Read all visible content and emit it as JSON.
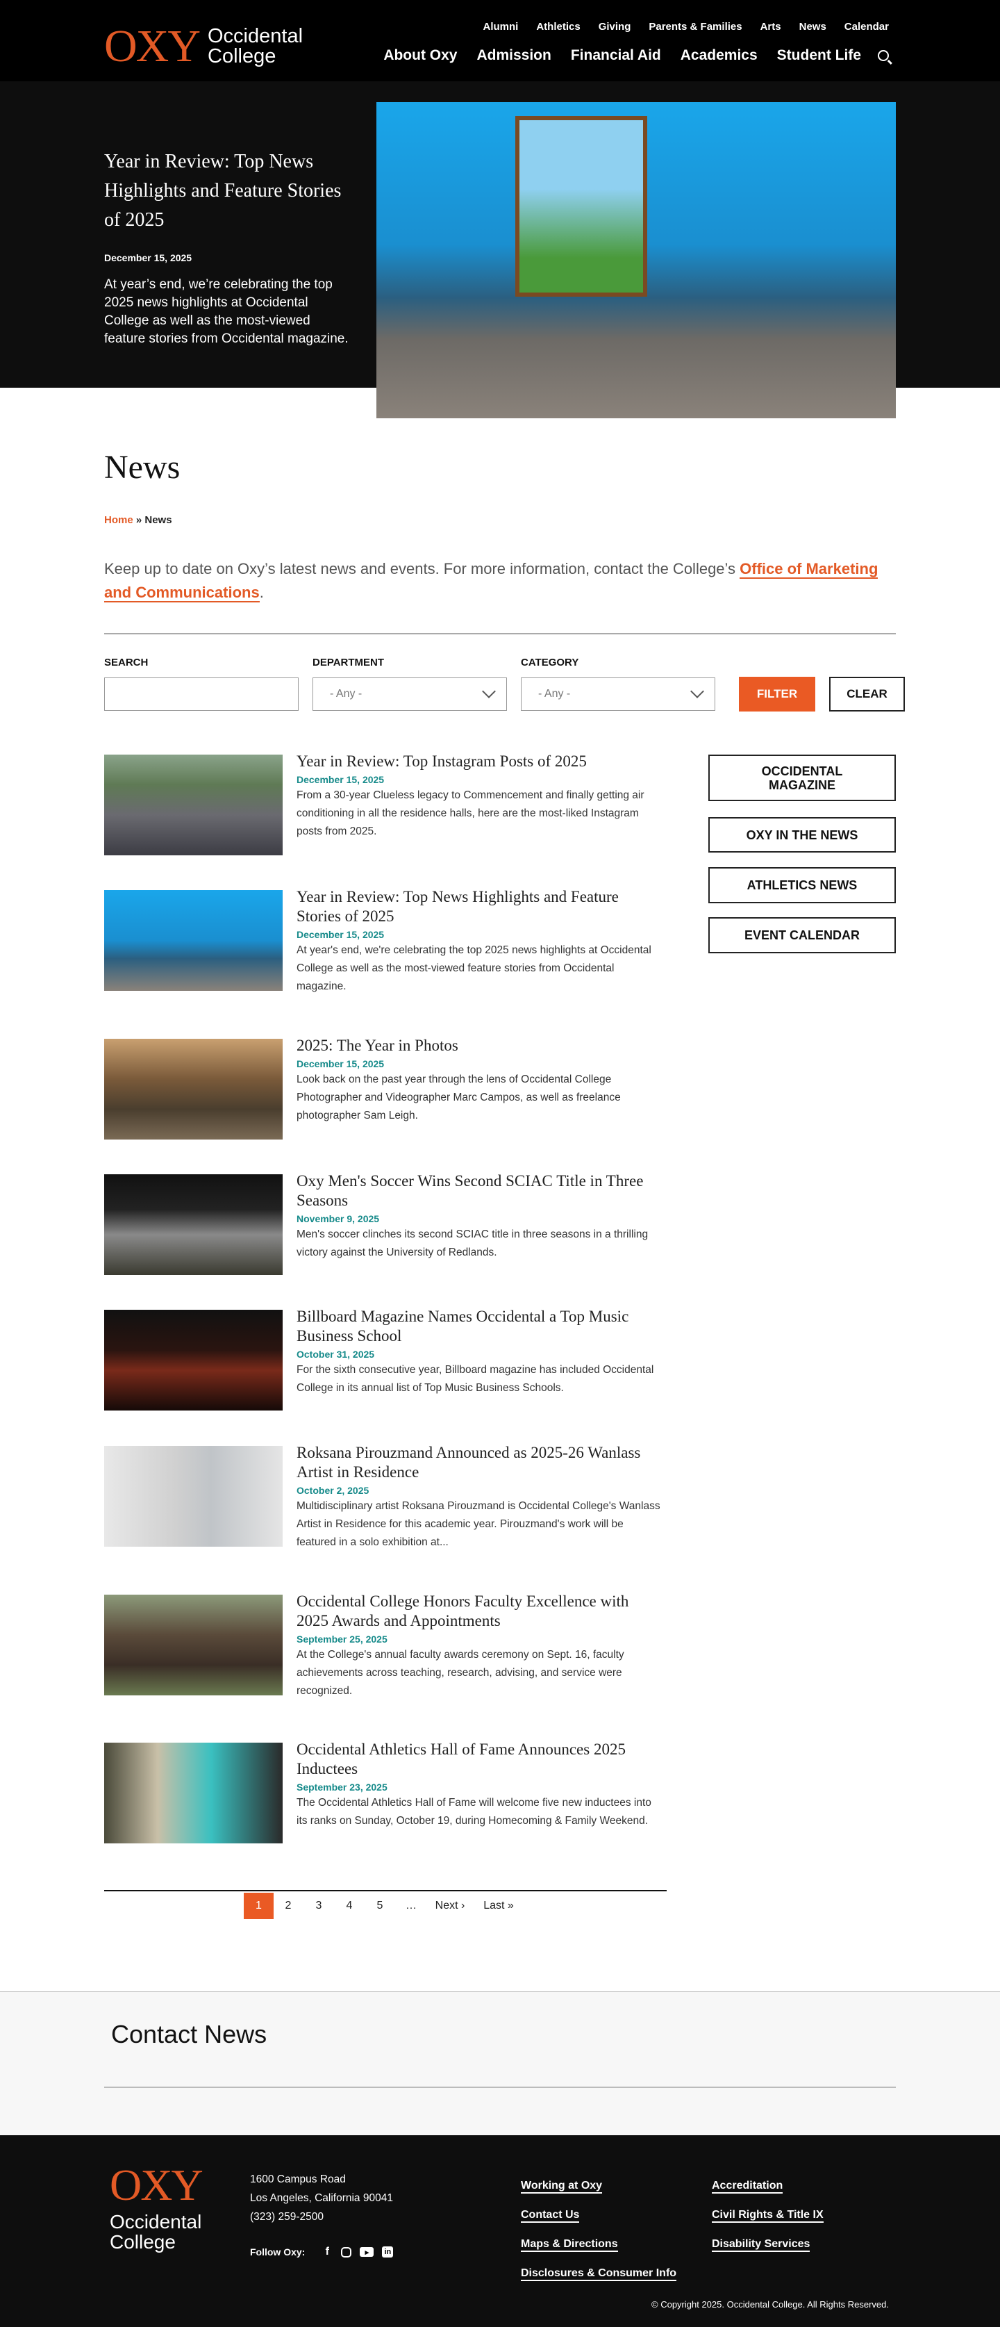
{
  "header": {
    "logo_mark": "OXY",
    "logo_line1": "Occidental",
    "logo_line2": "College",
    "utility_nav": [
      "Alumni",
      "Athletics",
      "Giving",
      "Parents & Families",
      "Arts",
      "News",
      "Calendar"
    ],
    "main_nav": [
      "About Oxy",
      "Admission",
      "Financial Aid",
      "Academics",
      "Student Life"
    ]
  },
  "hero": {
    "title": "Year in Review: Top News Highlights and Feature Stories of 2025",
    "date": "December 15, 2025",
    "description": "At year’s end, we’re celebrating the top 2025 news highlights at Occidental College as well as the most-viewed feature stories from Occidental magazine."
  },
  "page": {
    "title": "News",
    "breadcrumb_home": "Home",
    "breadcrumb_sep": "»",
    "breadcrumb_current": "News",
    "intro_text": "Keep up to date on Oxy’s latest news and events. For more information, contact the College’s ",
    "intro_link": "Office of Marketing and Communications",
    "intro_end": "."
  },
  "filters": {
    "search_label": "SEARCH",
    "search_value": "",
    "department_label": "DEPARTMENT",
    "department_value": "- Any -",
    "category_label": "CATEGORY",
    "category_value": "- Any -",
    "filter_button": "FILTER",
    "clear_button": "CLEAR"
  },
  "news": [
    {
      "title": "Year in Review: Top Instagram Posts of 2025",
      "date": "December 15, 2025",
      "desc": "From a 30-year Clueless legacy to Commencement and finally getting air conditioning in all the residence halls, here are the most-liked Instagram posts from 2025."
    },
    {
      "title": "Year in Review: Top News Highlights and Feature Stories of 2025",
      "date": "December 15, 2025",
      "desc": "At year's end, we're celebrating the top 2025 news highlights at Occidental College as well as the most-viewed feature stories from Occidental magazine."
    },
    {
      "title": "2025: The Year in Photos",
      "date": "December 15, 2025",
      "desc": "Look back on the past year through the lens of Occidental College Photographer and Videographer Marc Campos, as well as freelance photographer Sam Leigh."
    },
    {
      "title": "Oxy Men's Soccer Wins Second SCIAC Title in Three Seasons",
      "date": "November 9, 2025",
      "desc": "Men's soccer clinches its second SCIAC title in three seasons in a thrilling victory against the University of Redlands."
    },
    {
      "title": "Billboard Magazine Names Occidental a Top Music Business School",
      "date": "October 31, 2025",
      "desc": "For the sixth consecutive year, Billboard magazine has included Occidental College in its annual list of Top Music Business Schools."
    },
    {
      "title": "Roksana Pirouzmand Announced as 2025-26 Wanlass Artist in Residence",
      "date": "October 2, 2025",
      "desc": "Multidisciplinary artist Roksana Pirouzmand is Occidental College's Wanlass Artist in Residence for this academic year. Pirouzmand's work will be featured in a solo exhibition at..."
    },
    {
      "title": "Occidental College Honors Faculty Excellence with 2025 Awards and Appointments",
      "date": "September 25, 2025",
      "desc": "At the College's annual faculty awards ceremony on Sept. 16, faculty achievements across teaching, research, advising, and service were recognized."
    },
    {
      "title": "Occidental Athletics Hall of Fame Announces 2025 Inductees",
      "date": "September 23, 2025",
      "desc": "The Occidental Athletics Hall of Fame will welcome five new inductees into its ranks on Sunday, October 19, during Homecoming & Family Weekend."
    }
  ],
  "sidebar": [
    "OCCIDENTAL MAGAZINE",
    "OXY IN THE NEWS",
    "ATHLETICS NEWS",
    "EVENT CALENDAR"
  ],
  "pagination": {
    "pages": [
      "1",
      "2",
      "3",
      "4",
      "5",
      "…"
    ],
    "next": "Next ›",
    "last": "Last »",
    "current": "1"
  },
  "contact": {
    "title": "Contact News"
  },
  "footer": {
    "address1": "1600 Campus Road",
    "address2": "Los Angeles, California 90041",
    "phone": "(323) 259-2500",
    "follow": "Follow Oxy:",
    "links_col1": [
      "Working at Oxy",
      "Contact Us",
      "Maps & Directions",
      "Disclosures & Consumer Info"
    ],
    "links_col2": [
      "Accreditation",
      "Civil Rights & Title IX",
      "Disability Services"
    ],
    "copyright": "© Copyright 2025. Occidental College. All Rights Reserved."
  },
  "colors": {
    "accent": "#e35a26",
    "date": "#168a8a"
  }
}
